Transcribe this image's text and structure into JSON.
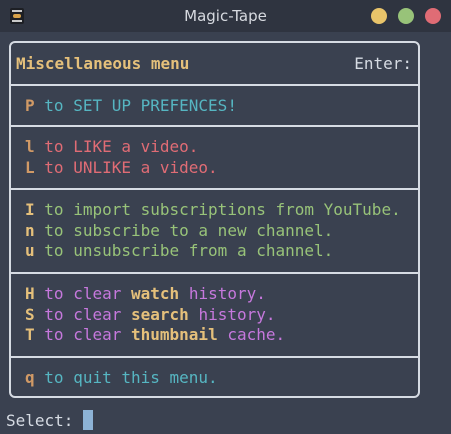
{
  "window": {
    "title": "Magic-Tape",
    "buttons": {
      "minimize": "minimize-button",
      "maximize": "maximize-button",
      "close": "close-button"
    }
  },
  "menu": {
    "title": "Miscellaneous menu",
    "enter_label": "Enter:",
    "sections": [
      {
        "items": [
          {
            "key": "P",
            "to": "to",
            "text": "SET UP PREFENCES!"
          }
        ]
      },
      {
        "items": [
          {
            "key": "l",
            "to": "to",
            "text": "LIKE a video."
          },
          {
            "key": "L",
            "to": "to",
            "text": "UNLIKE a video."
          }
        ]
      },
      {
        "items": [
          {
            "key": "I",
            "to": "to",
            "text": "import subscriptions from YouTube."
          },
          {
            "key": "n",
            "to": "to",
            "text": "subscribe to a new channel."
          },
          {
            "key": "u",
            "to": "to",
            "text": "unsubscribe from a channel."
          }
        ]
      },
      {
        "items": [
          {
            "key": "H",
            "to": "to",
            "pre": "clear",
            "highlight": "watch",
            "post": "history."
          },
          {
            "key": "S",
            "to": "to",
            "pre": "clear",
            "highlight": "search",
            "post": "history."
          },
          {
            "key": "T",
            "to": "to",
            "pre": "clear",
            "highlight": "thumbnail",
            "post": "cache."
          }
        ]
      },
      {
        "items": [
          {
            "key": "q",
            "to": "to",
            "text": "quit this menu."
          }
        ]
      }
    ]
  },
  "prompt": {
    "label": "Select:"
  },
  "colors": {
    "background": "#3a4150",
    "border": "#d6dbe3",
    "title": "#e5c07b",
    "cyan": "#56b6c2",
    "red": "#e06c75",
    "green": "#98c379",
    "purple": "#c678dd",
    "cursor": "#8db3d6"
  }
}
